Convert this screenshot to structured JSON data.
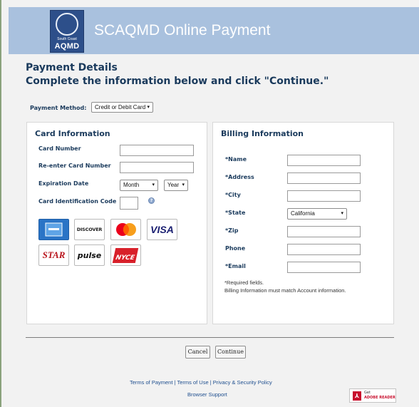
{
  "header": {
    "title": "SCAQMD Online Payment",
    "logo_small": "South Coast",
    "logo_big": "AQMD"
  },
  "page": {
    "heading": "Payment Details",
    "subheading": "Complete the information below and click \"Continue.\""
  },
  "payment_method": {
    "label": "Payment Method:",
    "value": "Credit or Debit Card"
  },
  "card_info": {
    "title": "Card Information",
    "card_number_label": "Card Number",
    "reenter_label": "Re-enter Card Number",
    "expiration_label": "Expiration Date",
    "month": "Month",
    "year": "Year",
    "cic_label": "Card Identification Code",
    "help_glyph": "?",
    "brands": [
      "American Express",
      "DISCOVER",
      "Mastercard",
      "VISA",
      "STAR",
      "pulse",
      "NYCE"
    ]
  },
  "billing": {
    "title": "Billing Information",
    "name_label": "*Name",
    "address_label": "*Address",
    "city_label": "*City",
    "state_label": "*State",
    "state_value": "California",
    "zip_label": "*Zip",
    "phone_label": "Phone",
    "email_label": "*Email",
    "note_required": "*Required fields.",
    "note_match": "Billing Information must match Account information."
  },
  "buttons": {
    "cancel": "Cancel",
    "continue": "Continue"
  },
  "footer": {
    "terms_payment": "Terms of Payment",
    "terms_use": "Terms of Use",
    "privacy": "Privacy & Security Policy",
    "separator": "|",
    "browser_support": "Browser Support",
    "adobe_get": "Get",
    "adobe_text": "ADOBE READER"
  },
  "icons": {
    "dropdown": "chevron-down-icon",
    "help": "help-icon",
    "pdf": "pdf-icon"
  }
}
